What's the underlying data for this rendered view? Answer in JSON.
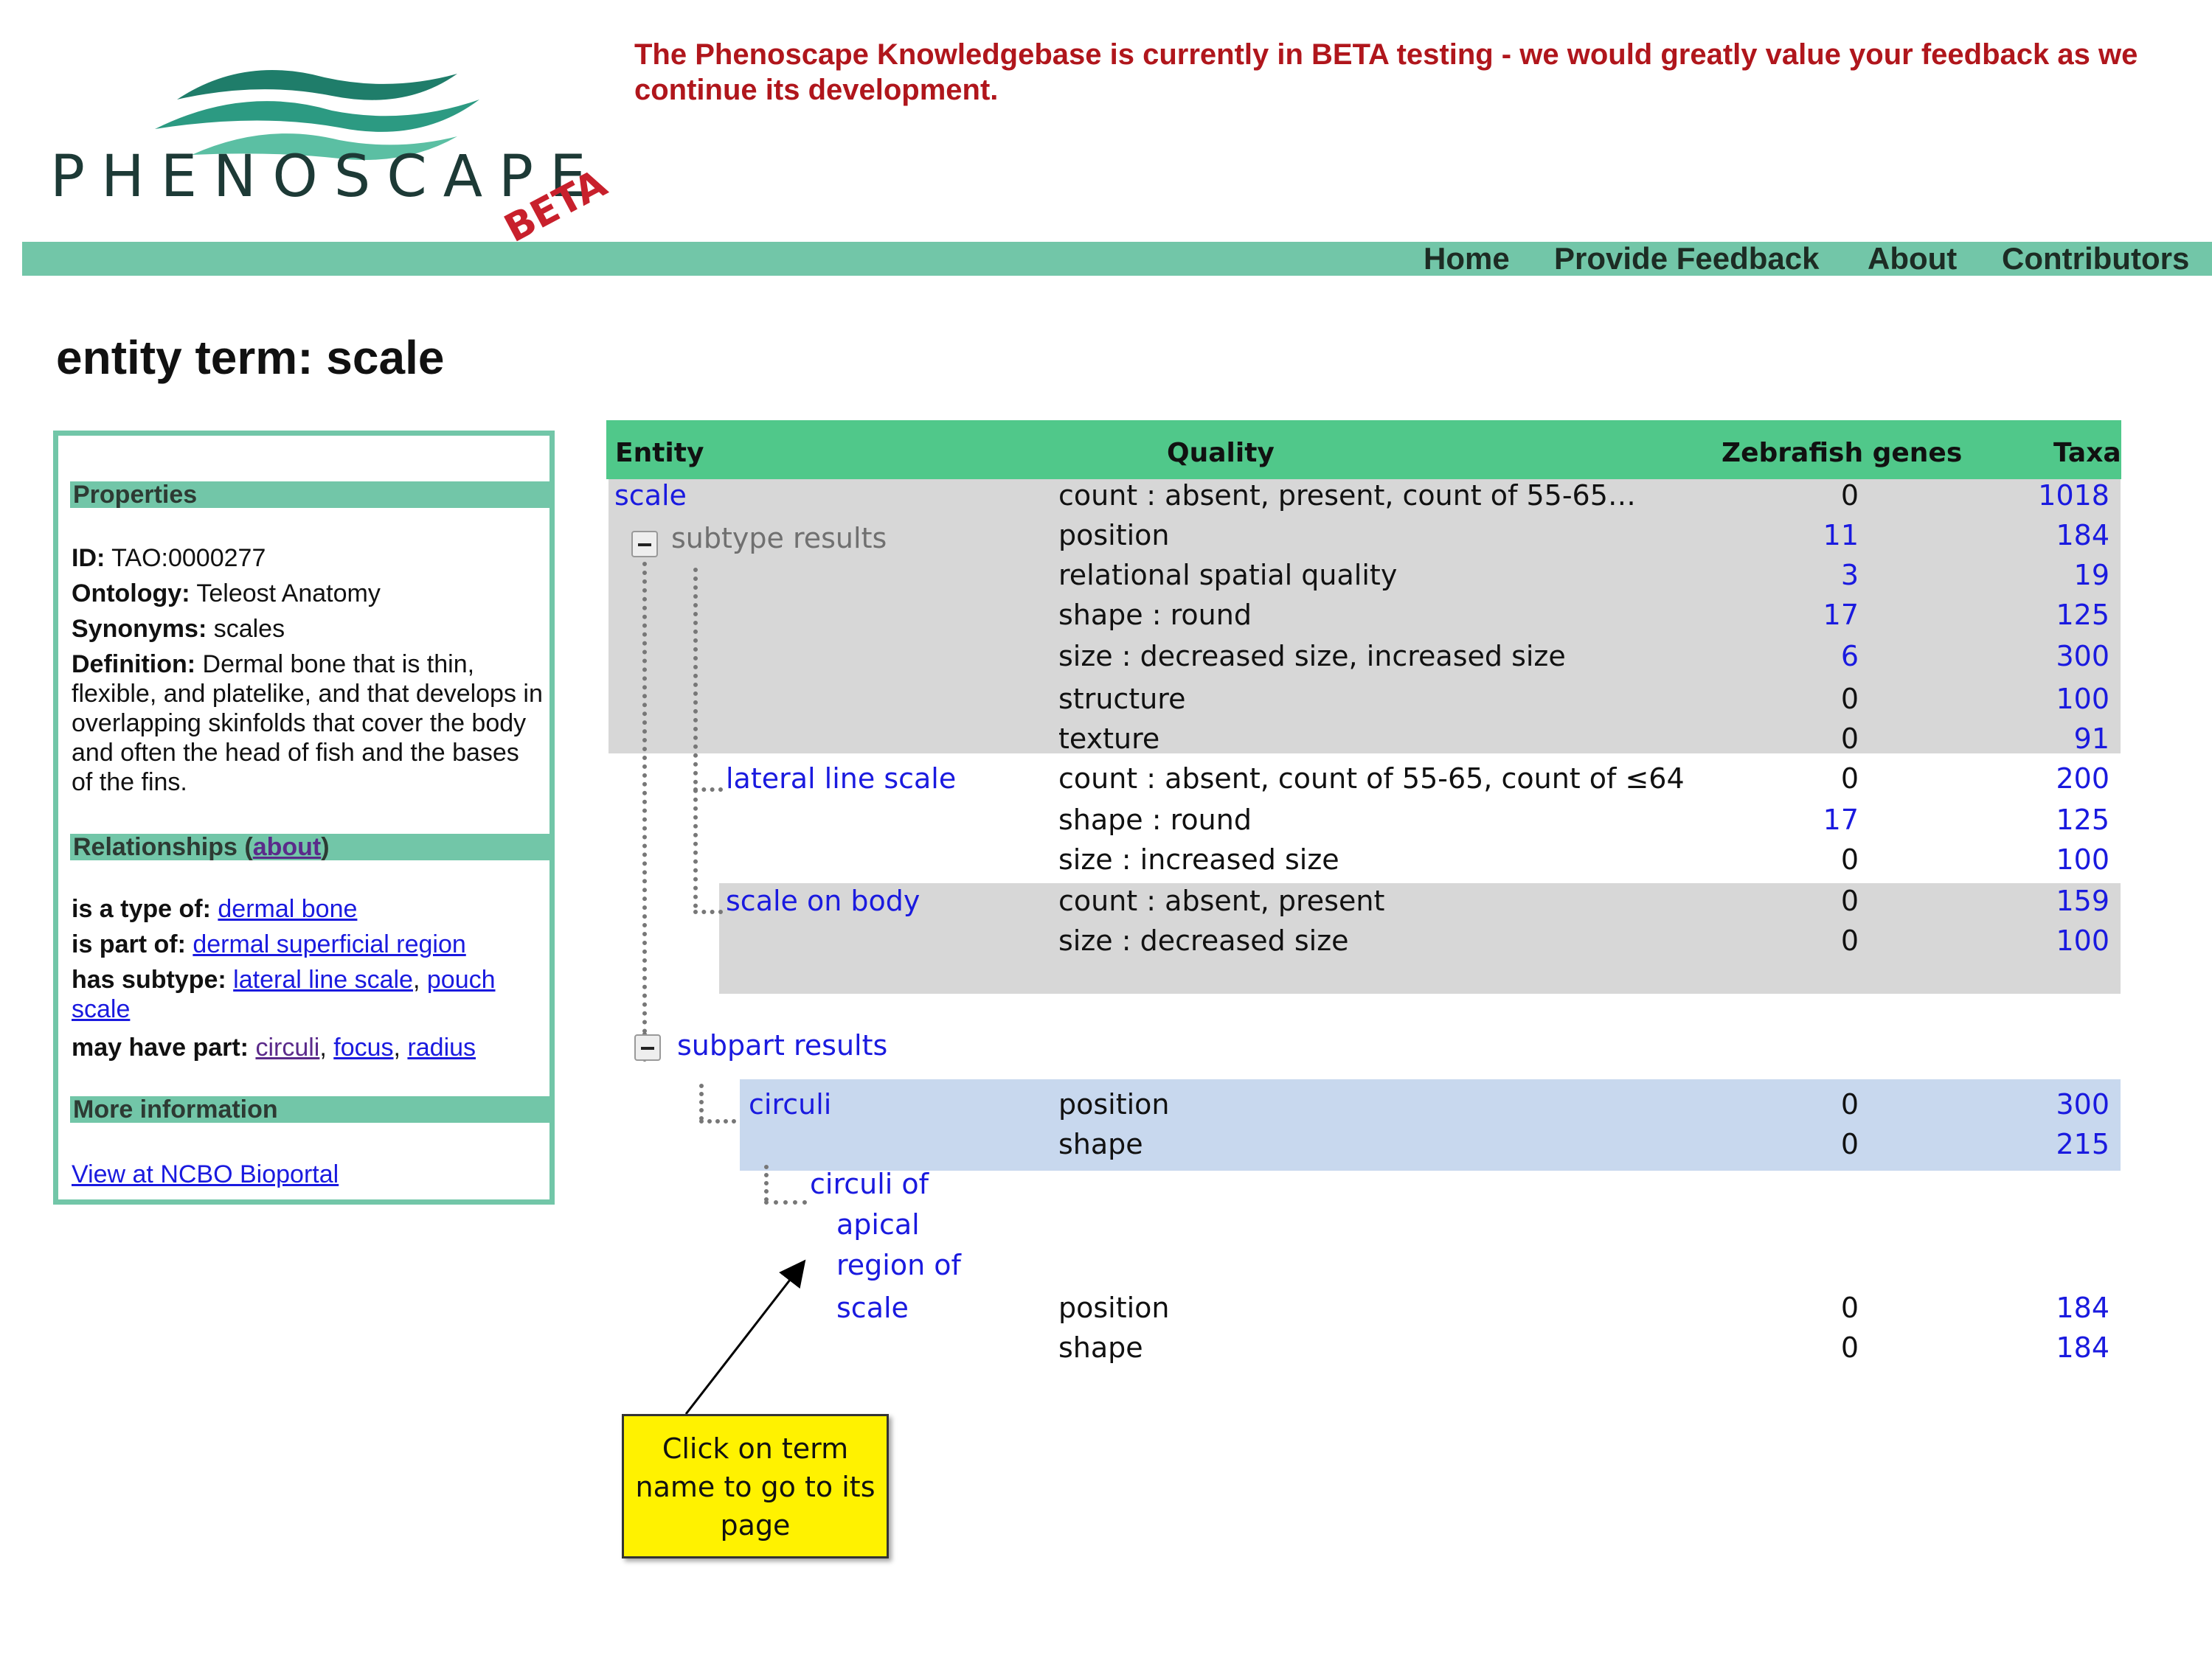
{
  "logo": {
    "wordmark": "PHENOSCAPE",
    "badge": "BETA"
  },
  "banner": {
    "text": "The Phenoscape Knowledgebase is currently in BETA testing - we would greatly value your feedback as we continue its development."
  },
  "nav": {
    "home": "Home",
    "feedback": "Provide Feedback",
    "about": "About",
    "contributors": "Contributors"
  },
  "page_title": "entity term: scale",
  "panel": {
    "properties_heading": "Properties",
    "id_label": "ID:",
    "id_value": "TAO:0000277",
    "ontology_label": "Ontology:",
    "ontology_value": "Teleost Anatomy",
    "synonyms_label": "Synonyms:",
    "synonyms_value": "scales",
    "definition_label": "Definition:",
    "definition_value": "Dermal bone that is thin, flexible, and platelike, and that develops in overlapping skinfolds that cover the body and often the head of fish and the bases of the fins.",
    "relationships_heading": "Relationships (",
    "relationships_about": "about",
    "relationships_close": ")",
    "is_type_label": "is a type of:",
    "is_type_link": "dermal bone",
    "is_part_label": "is part of:",
    "is_part_link": "dermal superficial region",
    "has_subtype_label": "has subtype:",
    "has_subtype_link1": "lateral line scale",
    "has_subtype_sep": ", ",
    "has_subtype_link2": "pouch scale",
    "may_have_part_label": "may have part:",
    "part1": "circuli",
    "part2": "focus",
    "part3": "radius",
    "sep": ", ",
    "more_info_heading": "More information",
    "bioportal_link": "View at NCBO Bioportal"
  },
  "table": {
    "headers": {
      "entity": "Entity",
      "quality": "Quality",
      "genes": "Zebrafish genes",
      "taxa": "Taxa"
    },
    "subtype_label": "subtype results",
    "subpart_label": "subpart results",
    "scale": {
      "name": "scale",
      "rows": [
        {
          "quality": "count : absent, present, count of 55-65…",
          "genes": "0",
          "taxa": "1018"
        },
        {
          "quality": "position",
          "genes": "11",
          "taxa": "184"
        },
        {
          "quality": "relational spatial quality",
          "genes": "3",
          "taxa": "19"
        },
        {
          "quality": "shape : round",
          "genes": "17",
          "taxa": "125"
        },
        {
          "quality": "size : decreased size, increased size",
          "genes": "6",
          "taxa": "300"
        },
        {
          "quality": "structure",
          "genes": "0",
          "taxa": "100"
        },
        {
          "quality": "texture",
          "genes": "0",
          "taxa": "91"
        }
      ]
    },
    "lateral_line_scale": {
      "name": "lateral line scale",
      "rows": [
        {
          "quality": "count : absent, count of 55-65, count of ≤64",
          "genes": "0",
          "taxa": "200"
        },
        {
          "quality": "shape : round",
          "genes": "17",
          "taxa": "125"
        },
        {
          "quality": "size : increased size",
          "genes": "0",
          "taxa": "100"
        }
      ]
    },
    "scale_on_body": {
      "name": "scale on body",
      "rows": [
        {
          "quality": "count : absent, present",
          "genes": "0",
          "taxa": "159"
        },
        {
          "quality": "size : decreased size",
          "genes": "0",
          "taxa": "100"
        }
      ]
    },
    "circuli": {
      "name": "circuli",
      "rows": [
        {
          "quality": "position",
          "genes": "0",
          "taxa": "300"
        },
        {
          "quality": "shape",
          "genes": "0",
          "taxa": "215"
        }
      ]
    },
    "circuli_apical": {
      "name_lines": [
        "circuli of",
        "apical",
        "region of",
        "scale"
      ],
      "rows": [
        {
          "quality": "position",
          "genes": "0",
          "taxa": "184"
        },
        {
          "quality": "shape",
          "genes": "0",
          "taxa": "184"
        }
      ]
    }
  },
  "callout": {
    "text": "Click on term name to go to its page"
  },
  "colors": {
    "banner_red": "#b0161c",
    "nav_teal": "#72c6a8",
    "table_header_green": "#50c88a",
    "link_blue": "#1a1adf",
    "callout_yellow": "#fff200"
  }
}
